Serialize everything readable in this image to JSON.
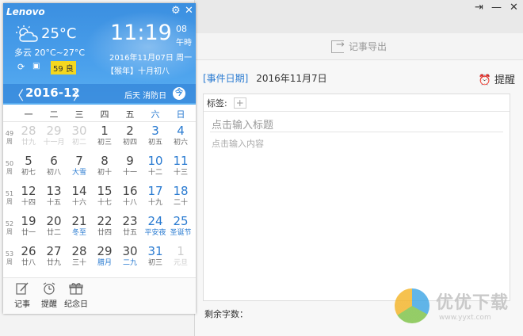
{
  "calendar": {
    "brand": "Lenovo",
    "weather": {
      "temp": "25°C",
      "desc": "多云 20°C~27°C",
      "aqi": "59 良",
      "icon": "partly-cloudy-icon"
    },
    "clock": {
      "time": "11:19",
      "seconds": "08",
      "ampm": "午時"
    },
    "date": "2016年11月07日 周一",
    "lunar": "【猴年】十月初八",
    "nav": {
      "prev": "〈",
      "year_month": "2016-12",
      "next": "〉",
      "holiday": "后天 消防日",
      "today": "今"
    },
    "weekdays": [
      "一",
      "二",
      "三",
      "四",
      "五",
      "六",
      "日"
    ],
    "week_numbers": [
      {
        "n": "49",
        "z": "周"
      },
      {
        "n": "50",
        "z": "周"
      },
      {
        "n": "51",
        "z": "周"
      },
      {
        "n": "52",
        "z": "周"
      },
      {
        "n": "53",
        "z": "周"
      }
    ],
    "weeks": [
      [
        {
          "d": "28",
          "l": "廿九",
          "m": true
        },
        {
          "d": "29",
          "l": "十一月",
          "m": true
        },
        {
          "d": "30",
          "l": "初二",
          "m": true
        },
        {
          "d": "1",
          "l": "初三"
        },
        {
          "d": "2",
          "l": "初四"
        },
        {
          "d": "3",
          "l": "初五"
        },
        {
          "d": "4",
          "l": "初六"
        }
      ],
      [
        {
          "d": "5",
          "l": "初七"
        },
        {
          "d": "6",
          "l": "初八"
        },
        {
          "d": "7",
          "l": "大雪",
          "f": true
        },
        {
          "d": "8",
          "l": "初十"
        },
        {
          "d": "9",
          "l": "十一"
        },
        {
          "d": "10",
          "l": "十二"
        },
        {
          "d": "11",
          "l": "十三"
        }
      ],
      [
        {
          "d": "12",
          "l": "十四"
        },
        {
          "d": "13",
          "l": "十五"
        },
        {
          "d": "14",
          "l": "十六"
        },
        {
          "d": "15",
          "l": "十七"
        },
        {
          "d": "16",
          "l": "十八"
        },
        {
          "d": "17",
          "l": "十九"
        },
        {
          "d": "18",
          "l": "二十"
        }
      ],
      [
        {
          "d": "19",
          "l": "廿一"
        },
        {
          "d": "20",
          "l": "廿二"
        },
        {
          "d": "21",
          "l": "冬至",
          "f": true
        },
        {
          "d": "22",
          "l": "廿四"
        },
        {
          "d": "23",
          "l": "廿五"
        },
        {
          "d": "24",
          "l": "平安夜",
          "f": true
        },
        {
          "d": "25",
          "l": "圣诞节",
          "f": true
        }
      ],
      [
        {
          "d": "26",
          "l": "廿八"
        },
        {
          "d": "27",
          "l": "廿九"
        },
        {
          "d": "28",
          "l": "三十"
        },
        {
          "d": "29",
          "l": "腊月",
          "f": true
        },
        {
          "d": "30",
          "l": "二九",
          "f": true
        },
        {
          "d": "31",
          "l": "初三"
        },
        {
          "d": "1",
          "l": "元旦",
          "m": true
        }
      ]
    ],
    "bottom": {
      "note": "记事",
      "remind": "提醒",
      "anniv": "纪念日"
    }
  },
  "editor": {
    "export": "记事导出",
    "event_label": "[事件日期]",
    "event_date": "2016年11月7日",
    "remind": "提醒",
    "tag_label": "标签:",
    "title_placeholder": "点击输入标题",
    "content_placeholder": "点击输入内容",
    "wordcount": "剩余字数："
  },
  "watermark": {
    "text": "优优下载",
    "url": "www.yyxt.com"
  }
}
